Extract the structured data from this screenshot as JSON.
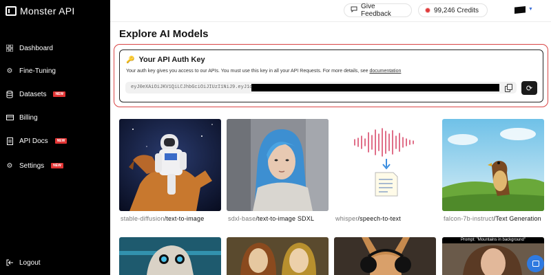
{
  "app": {
    "title": "Monster API"
  },
  "sidebar": {
    "items": [
      {
        "label": "Dashboard",
        "icon": "grid-icon",
        "badge": ""
      },
      {
        "label": "Fine-Tuning",
        "icon": "gear-icon",
        "badge": ""
      },
      {
        "label": "Datasets",
        "icon": "database-icon",
        "badge": "NEW"
      },
      {
        "label": "Billing",
        "icon": "card-icon",
        "badge": ""
      },
      {
        "label": "API Docs",
        "icon": "doc-icon",
        "badge": "NEW"
      },
      {
        "label": "Settings",
        "icon": "gear-icon",
        "badge": "NEW"
      }
    ],
    "logout": "Logout"
  },
  "header": {
    "feedback": "Give Feedback",
    "credits": "99,246 Credits"
  },
  "main": {
    "title": "Explore AI Models",
    "auth": {
      "title": "Your API Auth Key",
      "description": "Your auth key gives you access to our APIs. You must use this key in all your API Requests. For more details, see ",
      "doc_link": "documentation",
      "key_visible": "eyJ0eXAiOiJKV1QiLCJhbGciOiJIUzI1NiJ9.eyJ1c2Vy"
    },
    "cards": [
      {
        "model": "stable-diffusion",
        "task": "text-to-image"
      },
      {
        "model": "sdxl-base",
        "task": "text-to-image SDXL"
      },
      {
        "model": "whisper",
        "task": "speech-to-text"
      },
      {
        "model": "falcon-7b-instruct",
        "task": "Text Generation"
      }
    ],
    "row2_caption": "Prompt: \"Mountains in background\""
  },
  "colors": {
    "accent_red": "#d94343",
    "sidebar_bg": "#000000",
    "chat_blue": "#2f7ae0"
  }
}
